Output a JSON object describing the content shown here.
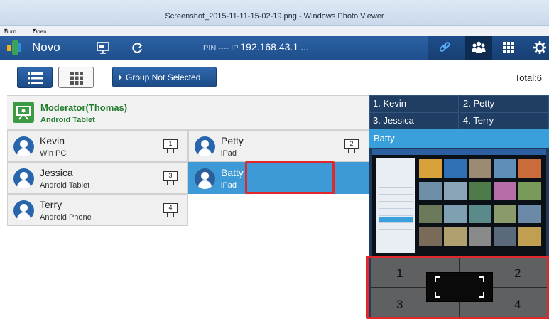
{
  "window": {
    "title": "Screenshot_2015-11-11-15-02-19.png - Windows Photo Viewer",
    "menu_burn": "Burn",
    "menu_open": "Open"
  },
  "topbar": {
    "app_name": "Novo",
    "pin_label": "PIN ---- IP",
    "ip": "192.168.43.1",
    "ellipsis": "...",
    "icons": [
      "screen-share-icon",
      "refresh-icon",
      "link-icon",
      "users-icon",
      "grid-icon",
      "gear-icon"
    ]
  },
  "toolbar": {
    "group_button": "Group Not Selected",
    "total": "Total:6"
  },
  "moderator": {
    "name": "Moderator(Thomas)",
    "device": "Android Tablet"
  },
  "participants": [
    {
      "name": "Kevin",
      "device": "Win PC",
      "screen": "1"
    },
    {
      "name": "Petty",
      "device": "iPad",
      "screen": "2"
    },
    {
      "name": "Jessica",
      "device": "Android Tablet",
      "screen": "3"
    },
    {
      "name": "Batty",
      "device": "iPad",
      "screen": ""
    },
    {
      "name": "Terry",
      "device": "Android Phone",
      "screen": "4"
    }
  ],
  "quadrants": [
    "1. Kevin",
    "2. Petty",
    "3. Jessica",
    "4. Terry"
  ],
  "preview": {
    "title": "Batty"
  },
  "screen_layout": {
    "numbers": [
      "1",
      "2",
      "3",
      "4"
    ]
  },
  "colors": {
    "brand_blue": "#1f4f8c",
    "selected_blue": "#3d9ad6",
    "moderator_green": "#1f7a2a",
    "highlight_red": "#e0282c"
  }
}
